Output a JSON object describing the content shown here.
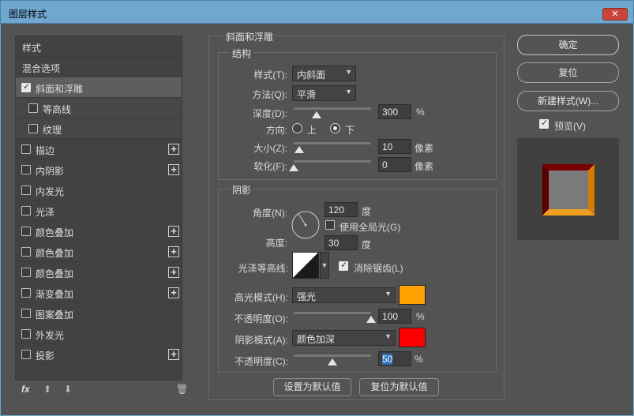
{
  "window": {
    "title": "图层样式",
    "close_glyph": "✕"
  },
  "style_list": {
    "header": "样式",
    "blend_options": "混合选项",
    "items": [
      {
        "label": "斜面和浮雕",
        "checked": true,
        "selected": true,
        "plus": false
      },
      {
        "label": "等高线",
        "checked": false,
        "sub": true,
        "plus": false
      },
      {
        "label": "纹理",
        "checked": false,
        "sub": true,
        "plus": false
      },
      {
        "label": "描边",
        "checked": false,
        "plus": true
      },
      {
        "label": "内阴影",
        "checked": false,
        "plus": true
      },
      {
        "label": "内发光",
        "checked": false,
        "plus": false
      },
      {
        "label": "光泽",
        "checked": false,
        "plus": false
      },
      {
        "label": "颜色叠加",
        "checked": false,
        "plus": true
      },
      {
        "label": "颜色叠加",
        "checked": false,
        "plus": true
      },
      {
        "label": "颜色叠加",
        "checked": false,
        "plus": true
      },
      {
        "label": "渐变叠加",
        "checked": false,
        "plus": true
      },
      {
        "label": "图案叠加",
        "checked": false,
        "plus": false
      },
      {
        "label": "外发光",
        "checked": false,
        "plus": false
      },
      {
        "label": "投影",
        "checked": false,
        "plus": true
      }
    ],
    "plus_glyph": "+",
    "bottom_icons": [
      "fx-icon",
      "arrow-up-icon",
      "arrow-down-icon",
      "trash-icon"
    ]
  },
  "bevel": {
    "title": "斜面和浮雕",
    "structure": {
      "title": "结构",
      "style_label": "样式(T):",
      "style_value": "内斜面",
      "technique_label": "方法(Q):",
      "technique_value": "平滑",
      "depth_label": "深度(D):",
      "depth_value": "300",
      "depth_unit": "%",
      "depth_slider": 0.3,
      "direction_label": "方向:",
      "direction_up": "上",
      "direction_down": "下",
      "direction_selected": "下",
      "size_label": "大小(Z):",
      "size_value": "10",
      "size_unit": "像素",
      "size_slider": 0.07,
      "soften_label": "软化(F):",
      "soften_value": "0",
      "soften_unit": "像素",
      "soften_slider": 0.0
    },
    "shading": {
      "title": "阴影",
      "angle_label": "角度(N):",
      "angle_value": "120",
      "angle_unit": "度",
      "global_light_label": "使用全局光(G)",
      "global_light_checked": false,
      "altitude_label": "高度:",
      "altitude_value": "30",
      "altitude_unit": "度",
      "gloss_contour_label": "光泽等高线:",
      "antialias_label": "消除锯齿(L)",
      "antialias_checked": true,
      "highlight_mode_label": "高光模式(H):",
      "highlight_mode_value": "强光",
      "highlight_color": "#ffa200",
      "highlight_opacity_label": "不透明度(O):",
      "highlight_opacity_value": "100",
      "highlight_opacity_unit": "%",
      "highlight_opacity_slider": 1.0,
      "shadow_mode_label": "阴影模式(A):",
      "shadow_mode_value": "颜色加深",
      "shadow_color": "#ff0000",
      "shadow_opacity_label": "不透明度(C):",
      "shadow_opacity_value": "50",
      "shadow_opacity_unit": "%",
      "shadow_opacity_slider": 0.5
    },
    "make_default": "设置为默认值",
    "reset_default": "复位为默认值"
  },
  "actions": {
    "ok": "确定",
    "reset": "复位",
    "new_style": "新建样式(W)...",
    "preview_label": "预览(V)",
    "preview_checked": true
  }
}
